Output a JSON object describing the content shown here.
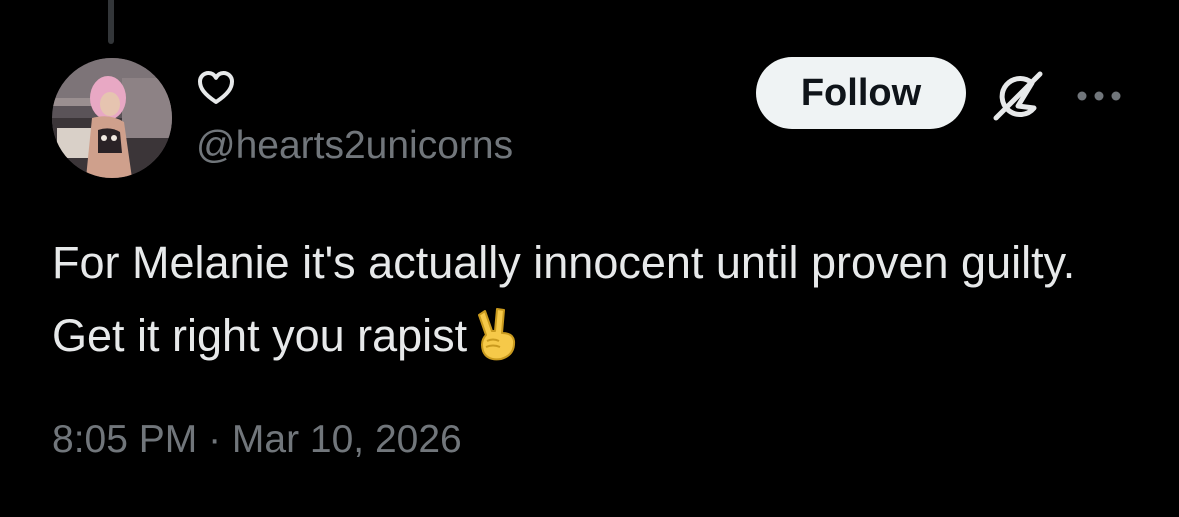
{
  "tweet": {
    "display_name_icon": "heart-outline-icon",
    "handle": "@hearts2unicorns",
    "follow_label": "Follow",
    "text": "For Melanie it's actually innocent until proven guilty. Get it right you rapist",
    "emoji": "victory-hand-emoji",
    "time": "8:05 PM",
    "separator": " · ",
    "date": "Mar 10, 2026"
  },
  "colors": {
    "background": "#000000",
    "primary_text": "#e7e9ea",
    "secondary_text": "#71767b",
    "follow_bg": "#eff3f4",
    "follow_text": "#0f1419",
    "emoji_skin": "#f6c949"
  }
}
